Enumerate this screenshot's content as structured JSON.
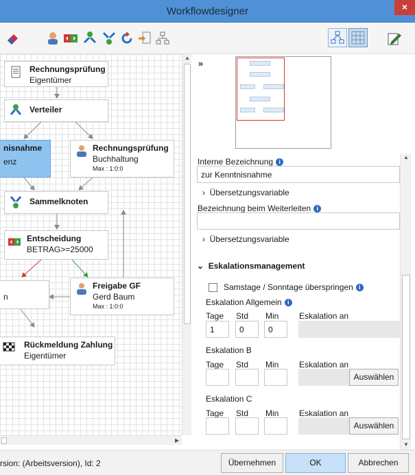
{
  "window": {
    "title": "Workflowdesigner",
    "close_label": "×"
  },
  "toolbar": {
    "icons": [
      "eraser-icon",
      "user-icon",
      "decision-icon",
      "distributor-icon",
      "merge-icon",
      "loop-icon",
      "import-icon",
      "layout-icon"
    ],
    "right_icons": [
      "connect-mode-icon",
      "grid-toggle-icon",
      "edit-icon"
    ]
  },
  "canvas": {
    "nodes": [
      {
        "title": "Rechnungsprüfung",
        "subtitle": "Eigentümer"
      },
      {
        "title": "Verteiler"
      },
      {
        "title": "nisnahme",
        "subtitle": "enz"
      },
      {
        "title": "Rechnungsprüfung",
        "subtitle": "Buchhaltung",
        "meta": "Max : 1:0:0"
      },
      {
        "title": "Sammelknoten"
      },
      {
        "title": "Entscheidung",
        "subtitle": "BETRAG>=25000"
      },
      {
        "subtitle": "n"
      },
      {
        "title": "Freigabe GF",
        "subtitle": "Gerd Baum",
        "meta": "Max : 1:0:0"
      },
      {
        "title": "Rückmeldung Zahlung",
        "subtitle": "Eigentümer"
      }
    ]
  },
  "panel": {
    "collapse_label": "»",
    "interne_bezeichnung": {
      "label": "Interne Bezeichnung",
      "value": "zur Kenntnisnahme"
    },
    "uebersetzung1": "Übersetzungsvariable",
    "bezeichnung_weiterleiten": {
      "label": "Bezeichnung beim Weiterleiten",
      "value": ""
    },
    "uebersetzung2": "Übersetzungsvariable",
    "eskalation": {
      "header": "Eskalationsmanagement",
      "skip_weekends_label": "Samstage / Sonntage überspringen",
      "skip_weekends_checked": false,
      "allgemein": {
        "label": "Eskalation Allgemein",
        "tage": "1",
        "std": "0",
        "min": "0"
      },
      "b": {
        "label": "Eskalation B",
        "tage": "",
        "std": "",
        "min": ""
      },
      "c": {
        "label": "Eskalation C",
        "tage": "",
        "std": "",
        "min": ""
      },
      "col_tage": "Tage",
      "col_std": "Std",
      "col_min": "Min",
      "col_an": "Eskalation an",
      "select_label": "Auswählen"
    }
  },
  "status": {
    "text": "rsion:  (Arbeitsversion), Id: 2"
  },
  "footer": {
    "apply_label": "Übernehmen",
    "ok_label": "OK",
    "cancel_label": "Abbrechen"
  },
  "colors": {
    "titlebar": "#4f90d6",
    "selected_node": "#8fc3f0",
    "close": "#c9403a",
    "primary_button": "#c7e1f8"
  }
}
